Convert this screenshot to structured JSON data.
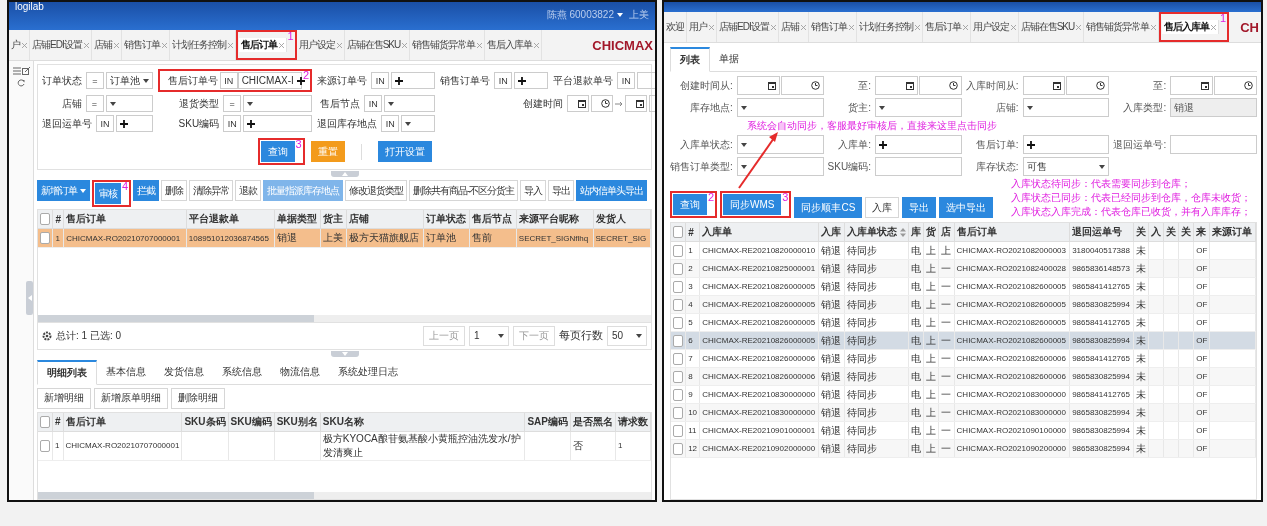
{
  "left_window": {
    "header": {
      "logo": "logilab",
      "user": "陈燕 60003822",
      "company": "上美"
    },
    "tabs": [
      {
        "label": "户",
        "selected": false,
        "closable": true
      },
      {
        "label": "店铺EDI设置",
        "selected": false,
        "closable": true
      },
      {
        "label": "店铺",
        "selected": false,
        "closable": true
      },
      {
        "label": "销售订单",
        "selected": false,
        "closable": true
      },
      {
        "label": "计划任务控制",
        "selected": false,
        "closable": true
      },
      {
        "label": "售后订单",
        "selected": true,
        "closable": true,
        "annotation": "1"
      },
      {
        "label": "用户设定",
        "selected": false,
        "closable": true
      },
      {
        "label": "店铺在售SKU",
        "selected": false,
        "closable": true
      },
      {
        "label": "销售铺货异常单",
        "selected": false,
        "closable": true
      },
      {
        "label": "售后入库单",
        "selected": false,
        "closable": true
      }
    ],
    "brand": "CHICMAX",
    "filter": {
      "fields": [
        {
          "kind": "select",
          "label": "订单状态",
          "op": "=",
          "value": "订单池"
        },
        {
          "kind": "multi",
          "label": "售后订单号",
          "op": "IN",
          "value": "CHICMAX-I",
          "annotation": "2"
        },
        {
          "kind": "multi",
          "label": "来源订单号",
          "op": "IN"
        },
        {
          "kind": "multi",
          "label": "销售订单号",
          "op": "IN"
        },
        {
          "kind": "text",
          "label": "平台退款单号",
          "op": "IN"
        },
        {
          "kind": "select",
          "label": "店铺",
          "op": "="
        },
        {
          "kind": "select",
          "label": "退货类型",
          "op": "="
        },
        {
          "kind": "select",
          "label": "售后节点",
          "op": "IN"
        },
        {
          "kind": "datetime",
          "label": "创建时间"
        },
        {
          "kind": "multi",
          "label": "退回运单号",
          "op": "IN"
        },
        {
          "kind": "multi",
          "label": "SKU编码",
          "op": "IN"
        },
        {
          "kind": "select",
          "label": "退回库存地点",
          "op": "IN"
        }
      ],
      "buttons": [
        {
          "label": "查询",
          "kind": "primary",
          "annotation": "3"
        },
        {
          "label": "重置",
          "kind": "warning"
        },
        {
          "label": "打开设置",
          "kind": "primary"
        }
      ]
    },
    "toolbar": [
      {
        "label": "新增订单",
        "kind": "primary",
        "dropdown": true
      },
      {
        "label": "审核",
        "kind": "primary",
        "dropdown": false,
        "annotation": "4"
      },
      {
        "label": "拦截",
        "kind": "primary",
        "dropdown": false
      },
      {
        "label": "删除",
        "kind": "default",
        "dropdown": false
      },
      {
        "label": "清除异常",
        "kind": "default",
        "dropdown": false
      },
      {
        "label": "退款",
        "kind": "default",
        "dropdown": false
      },
      {
        "label": "批量指派库存地点",
        "kind": "light",
        "dropdown": false
      },
      {
        "label": "修改退货类型",
        "kind": "default",
        "dropdown": false
      },
      {
        "label": "删除共有商品-不区分货主",
        "kind": "default",
        "dropdown": false
      },
      {
        "label": "导入",
        "kind": "default",
        "dropdown": false
      },
      {
        "label": "导出",
        "kind": "default",
        "dropdown": false
      },
      {
        "label": "站内信单头导出",
        "kind": "primary",
        "dropdown": false
      }
    ],
    "table": {
      "all_checked": false,
      "columns": [
        {
          "label": "#",
          "kind": "code"
        },
        {
          "label": "售后订单",
          "kind": "code"
        },
        {
          "label": "平台退款单",
          "kind": "code"
        },
        {
          "label": "单据类型",
          "kind": "text"
        },
        {
          "label": "货主",
          "kind": "text"
        },
        {
          "label": "店铺",
          "kind": "text"
        },
        {
          "label": "订单状态",
          "kind": "text"
        },
        {
          "label": "售后节点",
          "kind": "text"
        },
        {
          "label": "来源平台昵称",
          "kind": "code"
        },
        {
          "label": "发货人",
          "kind": "code"
        }
      ],
      "rows": [
        {
          "selected": true,
          "checked": false,
          "cells": [
            "1",
            "CHICMAX-RO20210707000001",
            "108951012036874565",
            "销退",
            "上美",
            "极方天猫旗舰店",
            "订单池",
            "售前",
            "SECRET_SIGNflhq",
            "SECRET_SIG"
          ]
        }
      ]
    },
    "footer": {
      "summary": "总计: 1 已选: 0",
      "prev": "上一页",
      "page": "1",
      "next": "下一页",
      "rows_label": "每页行数",
      "rows_per_page": "50"
    },
    "detail_tabs": [
      {
        "label": "明细列表",
        "selected": true
      },
      {
        "label": "基本信息",
        "selected": false
      },
      {
        "label": "发货信息",
        "selected": false
      },
      {
        "label": "系统信息",
        "selected": false
      },
      {
        "label": "物流信息",
        "selected": false
      },
      {
        "label": "系统处理日志",
        "selected": false
      }
    ],
    "detail_buttons": [
      "新增明细",
      "新增原单明细",
      "删除明细"
    ],
    "detail_table": {
      "all_checked": false,
      "columns": [
        {
          "label": "#",
          "kind": "code"
        },
        {
          "label": "售后订单",
          "kind": "code"
        },
        {
          "label": "SKU条码"
        },
        {
          "label": "SKU编码"
        },
        {
          "label": "SKU别名"
        },
        {
          "label": "SKU名称",
          "kind": "long"
        },
        {
          "label": "SAP编码"
        },
        {
          "label": "是否黑名",
          "kind": "text"
        },
        {
          "label": "请求数",
          "kind": "code"
        }
      ],
      "rows": [
        {
          "selected": false,
          "checked": false,
          "cells": [
            "1",
            "CHICMAX-RO20210707000001",
            null,
            null,
            null,
            "极方KYOCA酿苷氨基酸小黄瓶控油洗发水/护发清爽止",
            null,
            "否",
            "1"
          ]
        }
      ]
    }
  },
  "right_window": {
    "tabs": [
      {
        "label": "欢迎",
        "selected": false,
        "closable": false
      },
      {
        "label": "用户",
        "selected": false,
        "closable": true
      },
      {
        "label": "店铺EDI设置",
        "selected": false,
        "closable": true
      },
      {
        "label": "店铺",
        "selected": false,
        "closable": true
      },
      {
        "label": "销售订单",
        "selected": false,
        "closable": true
      },
      {
        "label": "计划任务控制",
        "selected": false,
        "closable": true
      },
      {
        "label": "售后订单",
        "selected": false,
        "closable": true
      },
      {
        "label": "用户设定",
        "selected": false,
        "closable": true
      },
      {
        "label": "店铺在售SKU",
        "selected": false,
        "closable": true
      },
      {
        "label": "销售铺货异常单",
        "selected": false,
        "closable": true
      },
      {
        "label": "售后入库单",
        "selected": true,
        "closable": true,
        "annotation": "1"
      }
    ],
    "brand": "CH",
    "subtabs": [
      {
        "label": "列表",
        "selected": true
      },
      {
        "label": "单据",
        "selected": false
      }
    ],
    "fields": [
      {
        "kind": "datetime",
        "label": "创建时间从:",
        "disabled": false
      },
      {
        "kind": "datetime",
        "label": "至:",
        "disabled": false
      },
      {
        "kind": "datetime",
        "label": "入库时间从:",
        "disabled": false
      },
      {
        "kind": "datetime",
        "label": "至:",
        "disabled": false
      },
      {
        "kind": "select",
        "label": "库存地点:",
        "disabled": false
      },
      {
        "kind": "select",
        "label": "货主:",
        "disabled": false
      },
      {
        "kind": "select",
        "label": "店铺:",
        "disabled": false
      },
      {
        "kind": "text",
        "label": "入库类型:",
        "value": "销退",
        "disabled": true
      },
      {
        "kind": "select",
        "label": "入库单状态:",
        "disabled": false
      },
      {
        "kind": "multi",
        "label": "入库单:",
        "disabled": false
      },
      {
        "kind": "multi",
        "label": "售后订单:",
        "disabled": false
      },
      {
        "kind": "text",
        "label": "退回运单号:",
        "disabled": false
      },
      {
        "kind": "select",
        "label": "销售订单类型:",
        "disabled": false
      },
      {
        "kind": "text",
        "label": "SKU编码:",
        "disabled": false
      },
      {
        "kind": "select",
        "label": "库存状态:",
        "value": "可售",
        "disabled": false
      }
    ],
    "callout": "系统会自动同步，客服最好审核后，直接来这里点击同步",
    "buttons": [
      {
        "label": "查询",
        "kind": "primary",
        "annotation": "2"
      },
      {
        "label": "同步WMS",
        "kind": "primary",
        "annotation": "3"
      },
      {
        "label": "同步顺丰CS",
        "kind": "primary"
      },
      {
        "label": "入库",
        "kind": "default"
      },
      {
        "label": "导出",
        "kind": "primary"
      },
      {
        "label": "选中导出",
        "kind": "primary"
      }
    ],
    "legend": [
      "入库状态待同步：代表需要同步到仓库；",
      "入库状态已同步：代表已经同步到仓库，仓库未收货；",
      "入库状态入库完成：代表仓库已收货，并有入库库存；"
    ],
    "table": {
      "all_checked": false,
      "columns": [
        {
          "label": "#",
          "kind": "code",
          "sortable": false
        },
        {
          "label": "入库单",
          "kind": "code",
          "sortable": false
        },
        {
          "label": "入库",
          "kind": "text",
          "sortable": false
        },
        {
          "label": "入库单状态",
          "kind": "text",
          "sortable": true
        },
        {
          "label": "库",
          "kind": "text",
          "sortable": false
        },
        {
          "label": "货",
          "kind": "text",
          "sortable": false
        },
        {
          "label": "店",
          "kind": "text",
          "sortable": false
        },
        {
          "label": "售后订单",
          "kind": "code",
          "sortable": false
        },
        {
          "label": "退回运单号",
          "kind": "code",
          "sortable": false
        },
        {
          "label": "关",
          "kind": "text",
          "sortable": false
        },
        {
          "label": "入",
          "sortable": false
        },
        {
          "label": "关",
          "sortable": false
        },
        {
          "label": "关",
          "sortable": false
        },
        {
          "label": "来",
          "kind": "code",
          "sortable": false
        },
        {
          "label": "来源订单",
          "sortable": false
        }
      ],
      "rows": [
        {
          "selected": false,
          "checked": false,
          "cells": [
            "1",
            "CHICMAX-RE20210820000010",
            "销退",
            "待同步",
            "电",
            "上",
            "上",
            "CHICMAX-RO2021082000003",
            "3180040517388",
            "未",
            null,
            null,
            null,
            "OF",
            null
          ]
        },
        {
          "selected": false,
          "checked": false,
          "cells": [
            "2",
            "CHICMAX-RE20210825000001",
            "销退",
            "待同步",
            "电",
            "上",
            "一",
            "CHICMAX-RO2021082400028",
            "9865836148573",
            "未",
            null,
            null,
            null,
            "OF",
            null
          ]
        },
        {
          "selected": false,
          "checked": false,
          "cells": [
            "3",
            "CHICMAX-RE20210826000005",
            "销退",
            "待同步",
            "电",
            "上",
            "一",
            "CHICMAX-RO2021082600005",
            "9865841412765",
            "未",
            null,
            null,
            null,
            "OF",
            null
          ]
        },
        {
          "selected": false,
          "checked": false,
          "cells": [
            "4",
            "CHICMAX-RE20210826000005",
            "销退",
            "待同步",
            "电",
            "上",
            "一",
            "CHICMAX-RO2021082600005",
            "9865830825994",
            "未",
            null,
            null,
            null,
            "OF",
            null
          ]
        },
        {
          "selected": false,
          "checked": false,
          "cells": [
            "5",
            "CHICMAX-RE20210826000005",
            "销退",
            "待同步",
            "电",
            "上",
            "一",
            "CHICMAX-RO2021082600005",
            "9865841412765",
            "未",
            null,
            null,
            null,
            "OF",
            null
          ]
        },
        {
          "selected": true,
          "checked": false,
          "cells": [
            "6",
            "CHICMAX-RE20210826000005",
            "销退",
            "待同步",
            "电",
            "上",
            "一",
            "CHICMAX-RO2021082600005",
            "9865830825994",
            "未",
            null,
            null,
            null,
            "OF",
            null
          ]
        },
        {
          "selected": false,
          "checked": false,
          "cells": [
            "7",
            "CHICMAX-RE20210826000006",
            "销退",
            "待同步",
            "电",
            "上",
            "一",
            "CHICMAX-RO2021082600006",
            "9865841412765",
            "未",
            null,
            null,
            null,
            "OF",
            null
          ]
        },
        {
          "selected": false,
          "checked": false,
          "cells": [
            "8",
            "CHICMAX-RE20210826000006",
            "销退",
            "待同步",
            "电",
            "上",
            "一",
            "CHICMAX-RO2021082600006",
            "9865830825994",
            "未",
            null,
            null,
            null,
            "OF",
            null
          ]
        },
        {
          "selected": false,
          "checked": false,
          "cells": [
            "9",
            "CHICMAX-RE20210830000000",
            "销退",
            "待同步",
            "电",
            "上",
            "一",
            "CHICMAX-RO2021083000000",
            "9865841412765",
            "未",
            null,
            null,
            null,
            "OF",
            null
          ]
        },
        {
          "selected": false,
          "checked": false,
          "cells": [
            "10",
            "CHICMAX-RE20210830000000",
            "销退",
            "待同步",
            "电",
            "上",
            "一",
            "CHICMAX-RO2021083000000",
            "9865830825994",
            "未",
            null,
            null,
            null,
            "OF",
            null
          ]
        },
        {
          "selected": false,
          "checked": false,
          "cells": [
            "11",
            "CHICMAX-RE20210901000001",
            "销退",
            "待同步",
            "电",
            "上",
            "一",
            "CHICMAX-RO2021090100000",
            "9865830825994",
            "未",
            null,
            null,
            null,
            "OF",
            null
          ]
        },
        {
          "selected": false,
          "checked": false,
          "cells": [
            "12",
            "CHICMAX-RE20210902000000",
            "销退",
            "待同步",
            "电",
            "上",
            "一",
            "CHICMAX-RO2021090200000",
            "9865830825994",
            "未",
            null,
            null,
            null,
            "OF",
            null
          ]
        }
      ]
    }
  }
}
